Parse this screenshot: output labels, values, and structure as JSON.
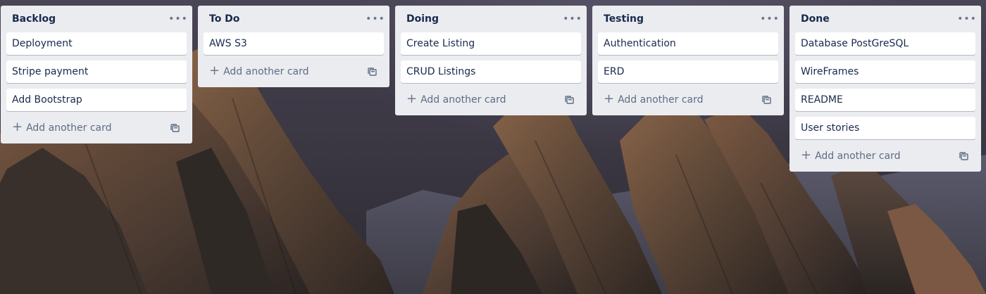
{
  "board": {
    "background_color": "#3e3a47",
    "list_color": "#ebecf0",
    "lists": [
      {
        "title": "Backlog",
        "cards": [
          "Deployment",
          "Stripe payment",
          "Add Bootstrap"
        ],
        "add_label": "Add another card"
      },
      {
        "title": "To Do",
        "cards": [
          "AWS S3"
        ],
        "add_label": "Add another card"
      },
      {
        "title": "Doing",
        "cards": [
          "Create Listing",
          "CRUD Listings"
        ],
        "add_label": "Add another card"
      },
      {
        "title": "Testing",
        "cards": [
          "Authentication",
          "ERD"
        ],
        "add_label": "Add another card"
      },
      {
        "title": "Done",
        "cards": [
          "Database PostGreSQL",
          "WireFrames",
          "README",
          "User stories"
        ],
        "add_label": "Add another card"
      }
    ],
    "icons": {
      "list_menu": "ellipsis-icon",
      "add": "plus-icon",
      "template": "card-template-icon"
    }
  }
}
